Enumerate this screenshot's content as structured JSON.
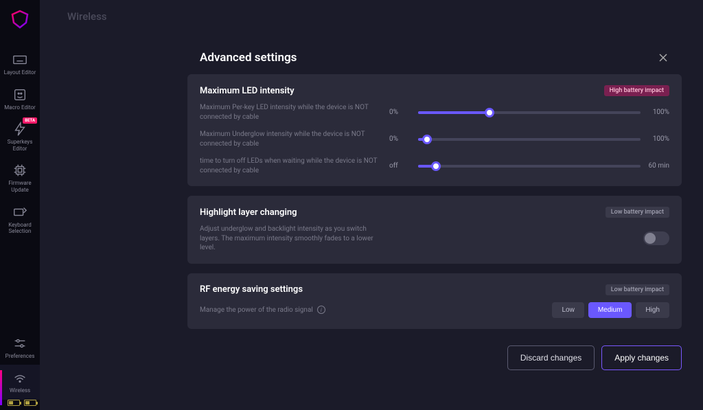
{
  "page": {
    "title": "Wireless"
  },
  "sidebar": {
    "items": [
      {
        "label": "Layout\nEditor",
        "icon": "keyboard-icon"
      },
      {
        "label": "Macro\nEditor",
        "icon": "macro-icon"
      },
      {
        "label": "Superkeys\nEditor",
        "icon": "bolt-icon",
        "badge": "BETA"
      },
      {
        "label": "Firmware\nUpdate",
        "icon": "chip-icon"
      },
      {
        "label": "Keyboard\nSelection",
        "icon": "keyboard-select-icon"
      }
    ],
    "bottom": [
      {
        "label": "Preferences",
        "icon": "sliders-icon"
      },
      {
        "label": "Wireless",
        "icon": "wifi-icon"
      }
    ]
  },
  "modal": {
    "title": "Advanced settings",
    "cards": {
      "led": {
        "title": "Maximum LED intensity",
        "impact_label": "High battery impact",
        "sliders": [
          {
            "desc": "Maximum Per-key LED intensity while the device is NOT connected by cable",
            "min": "0%",
            "max": "100%",
            "pct": 32
          },
          {
            "desc": "Maximum Underglow intensity while the device is NOT connected by cable",
            "min": "0%",
            "max": "100%",
            "pct": 4
          },
          {
            "desc": "time to turn off LEDs when waiting while the device is NOT connected by cable",
            "min": "off",
            "max": "60 min",
            "pct": 8
          }
        ]
      },
      "highlight": {
        "title": "Highlight layer changing",
        "impact_label": "Low battery impact",
        "desc": "Adjust underglow and backlight intensity as you switch layers. The maximum intensity smoothly fades to a lower level.",
        "enabled": false
      },
      "rf": {
        "title": "RF energy saving settings",
        "impact_label": "Low battery impact",
        "desc": "Manage the power of the radio signal",
        "options": [
          "Low",
          "Medium",
          "High"
        ],
        "selected": 1
      }
    },
    "footer": {
      "discard": "Discard changes",
      "apply": "Apply changes"
    }
  }
}
